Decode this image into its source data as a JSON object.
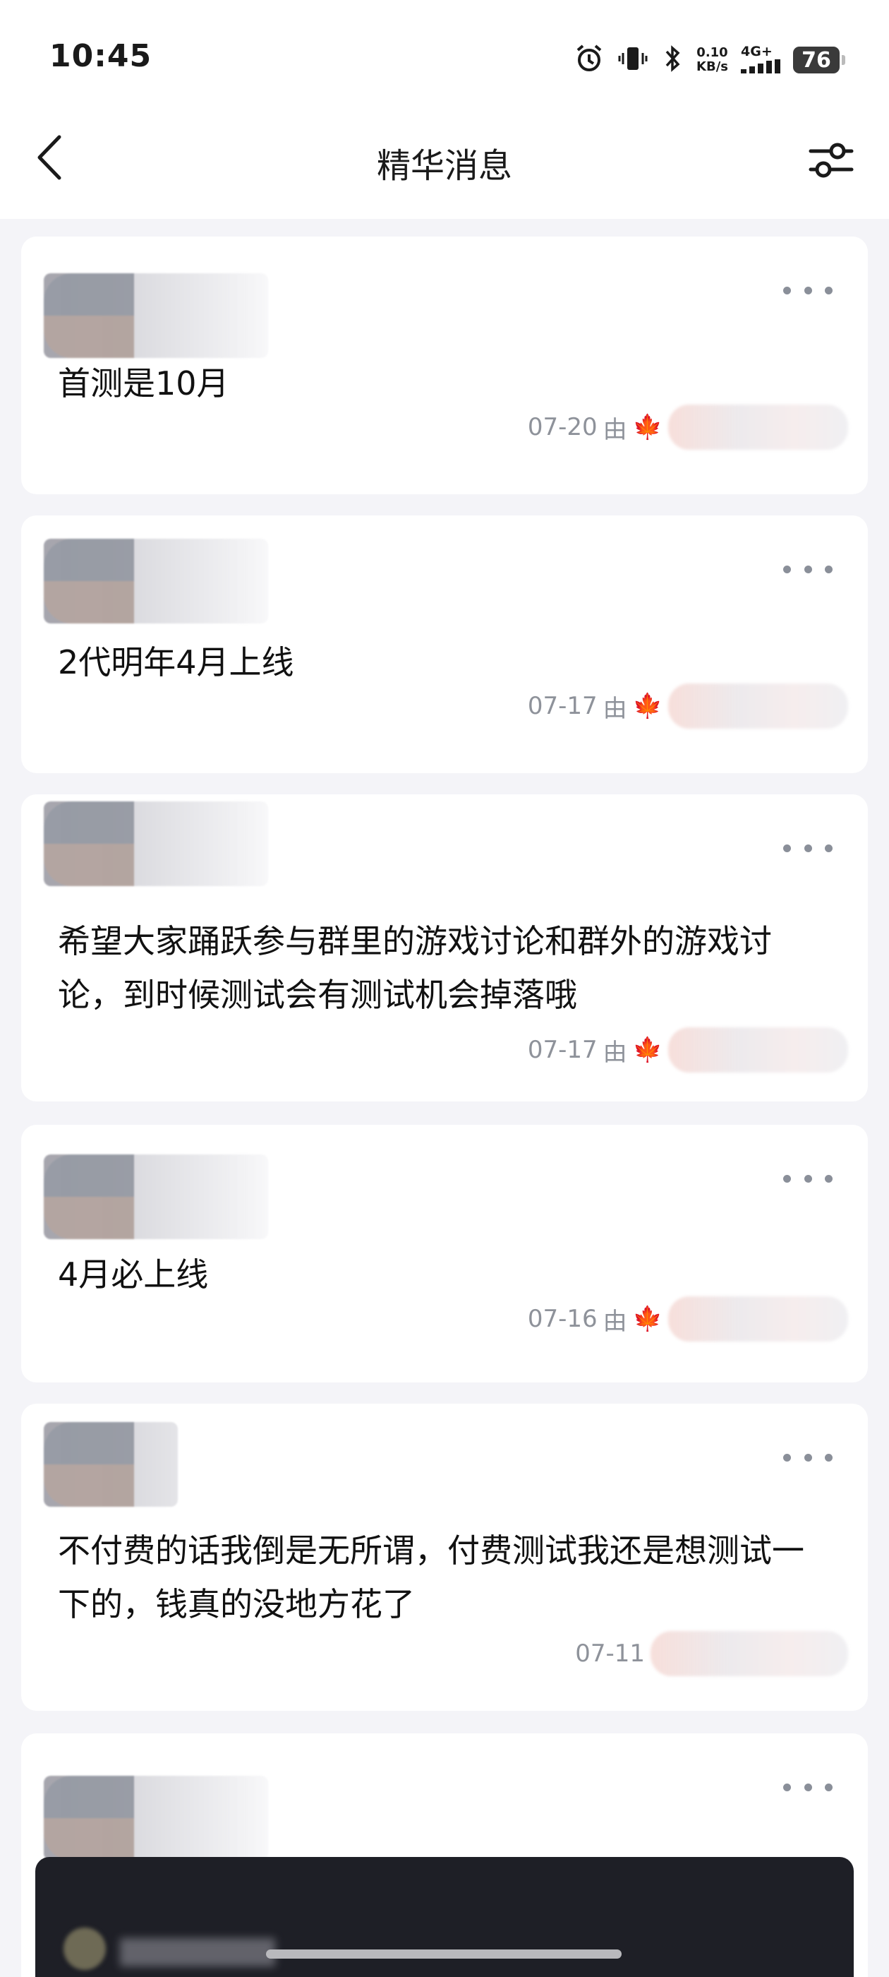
{
  "status_bar": {
    "time": "10:45",
    "speed_value": "0.10",
    "speed_unit": "KB/s",
    "network": "4G+",
    "battery": "76"
  },
  "header": {
    "title": "精华消息"
  },
  "messages": [
    {
      "text": "首测是10月",
      "date": "07-20",
      "by": "由"
    },
    {
      "text": "2代明年4月上线",
      "date": "07-17",
      "by": "由"
    },
    {
      "text": "希望大家踊跃参与群里的游戏讨论和群外的游戏讨论，到时候测试会有测试机会掉落哦",
      "date": "07-17",
      "by": "由"
    },
    {
      "text": "4月必上线",
      "date": "07-16",
      "by": "由"
    },
    {
      "text": "不付费的话我倒是无所谓，付费测试我还是想测试一下的，钱真的没地方花了",
      "date": "07-11",
      "by": ""
    }
  ],
  "icons": {
    "back": "chevron-left-icon",
    "filter": "sliders-icon",
    "more": "more-icon",
    "maple": "maple-leaf-icon"
  }
}
